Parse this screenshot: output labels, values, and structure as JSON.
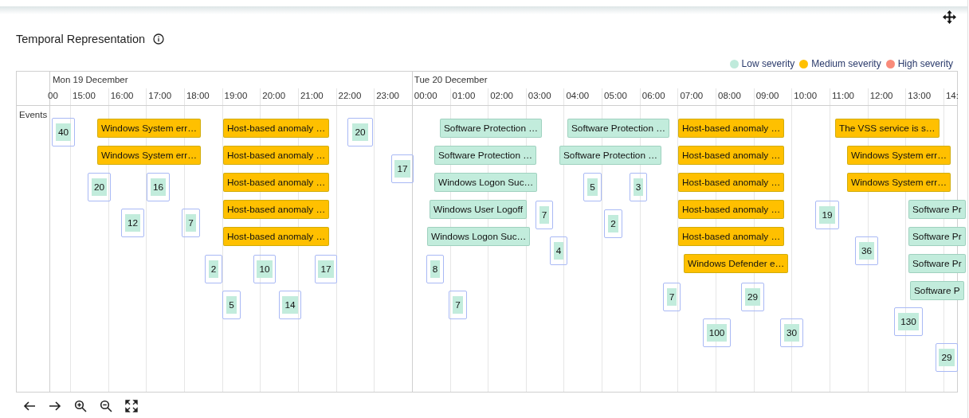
{
  "panel": {
    "title": "Temporal Representation"
  },
  "legend": [
    {
      "label": "Low severity",
      "color": "#bfeadb"
    },
    {
      "label": "Medium severity",
      "color": "#ffc000"
    },
    {
      "label": "High severity",
      "color": "#f98b7a"
    }
  ],
  "timeline": {
    "row_label": "Events",
    "days": [
      {
        "label": "Mon 19 December"
      },
      {
        "label": "Tue 20 December"
      }
    ],
    "hours": [
      {
        "label": "00"
      },
      {
        "label": "15:00"
      },
      {
        "label": "16:00"
      },
      {
        "label": "17:00"
      },
      {
        "label": "18:00"
      },
      {
        "label": "19:00"
      },
      {
        "label": "20:00"
      },
      {
        "label": "21:00"
      },
      {
        "label": "22:00"
      },
      {
        "label": "23:00"
      },
      {
        "label": "00:00"
      },
      {
        "label": "01:00"
      },
      {
        "label": "02:00"
      },
      {
        "label": "03:00"
      },
      {
        "label": "04:00"
      },
      {
        "label": "05:00"
      },
      {
        "label": "06:00"
      },
      {
        "label": "07:00"
      },
      {
        "label": "08:00"
      },
      {
        "label": "09:00"
      },
      {
        "label": "10:00"
      },
      {
        "label": "11:00"
      },
      {
        "label": "12:00"
      },
      {
        "label": "13:00"
      },
      {
        "label": "14:"
      }
    ],
    "events": [
      {
        "kind": "count",
        "text": "40",
        "color": "#c2ecdc"
      },
      {
        "kind": "label",
        "text": "Windows System err…",
        "color": "#ffc000"
      },
      {
        "kind": "label",
        "text": "Host-based anomaly …",
        "color": "#ffc000"
      },
      {
        "kind": "count",
        "text": "20",
        "color": "#c2ecdc"
      },
      {
        "kind": "label",
        "text": "Software Protection …",
        "color": "#c2ecdc"
      },
      {
        "kind": "label",
        "text": "Software Protection …",
        "color": "#c2ecdc"
      },
      {
        "kind": "label",
        "text": "Host-based anomaly …",
        "color": "#ffc000"
      },
      {
        "kind": "label",
        "text": "The VSS service is s…",
        "color": "#ffc000"
      },
      {
        "kind": "label",
        "text": "Windows System err…",
        "color": "#ffc000"
      },
      {
        "kind": "label",
        "text": "Host-based anomaly …",
        "color": "#ffc000"
      },
      {
        "kind": "label",
        "text": "Software Protection …",
        "color": "#c2ecdc"
      },
      {
        "kind": "label",
        "text": "Software Protection …",
        "color": "#c2ecdc"
      },
      {
        "kind": "label",
        "text": "Host-based anomaly …",
        "color": "#ffc000"
      },
      {
        "kind": "label",
        "text": "Windows System err…",
        "color": "#ffc000"
      },
      {
        "kind": "count",
        "text": "17",
        "color": "#c2ecdc"
      },
      {
        "kind": "count",
        "text": "20",
        "color": "#c2ecdc"
      },
      {
        "kind": "count",
        "text": "16",
        "color": "#c2ecdc"
      },
      {
        "kind": "label",
        "text": "Host-based anomaly …",
        "color": "#ffc000"
      },
      {
        "kind": "label",
        "text": "Windows Logon Suc…",
        "color": "#c2ecdc"
      },
      {
        "kind": "count",
        "text": "5",
        "color": "#c2ecdc"
      },
      {
        "kind": "count",
        "text": "3",
        "color": "#c2ecdc"
      },
      {
        "kind": "label",
        "text": "Host-based anomaly …",
        "color": "#ffc000"
      },
      {
        "kind": "label",
        "text": "Windows System err…",
        "color": "#ffc000"
      },
      {
        "kind": "label",
        "text": "Host-based anomaly …",
        "color": "#ffc000"
      },
      {
        "kind": "label",
        "text": "Windows User Logoff",
        "color": "#c2ecdc"
      },
      {
        "kind": "count",
        "text": "7",
        "color": "#c2ecdc"
      },
      {
        "kind": "label",
        "text": "Host-based anomaly …",
        "color": "#ffc000"
      },
      {
        "kind": "count",
        "text": "19",
        "color": "#c2ecdc"
      },
      {
        "kind": "label",
        "text": "Software Pr",
        "color": "#c2ecdc"
      },
      {
        "kind": "count",
        "text": "12",
        "color": "#c2ecdc"
      },
      {
        "kind": "count",
        "text": "7",
        "color": "#c2ecdc"
      },
      {
        "kind": "count",
        "text": "2",
        "color": "#c2ecdc"
      },
      {
        "kind": "label",
        "text": "Host-based anomaly …",
        "color": "#ffc000"
      },
      {
        "kind": "label",
        "text": "Windows Logon Suc…",
        "color": "#c2ecdc"
      },
      {
        "kind": "label",
        "text": "Host-based anomaly …",
        "color": "#ffc000"
      },
      {
        "kind": "label",
        "text": "Software Pr",
        "color": "#c2ecdc"
      },
      {
        "kind": "count",
        "text": "4",
        "color": "#c2ecdc"
      },
      {
        "kind": "count",
        "text": "36",
        "color": "#c2ecdc"
      },
      {
        "kind": "count",
        "text": "2",
        "color": "#c2ecdc"
      },
      {
        "kind": "count",
        "text": "10",
        "color": "#c2ecdc"
      },
      {
        "kind": "count",
        "text": "17",
        "color": "#c2ecdc"
      },
      {
        "kind": "count",
        "text": "8",
        "color": "#c2ecdc"
      },
      {
        "kind": "label",
        "text": "Windows Defender e…",
        "color": "#ffc000"
      },
      {
        "kind": "label",
        "text": "Software Pr",
        "color": "#c2ecdc"
      },
      {
        "kind": "label",
        "text": "Software P",
        "color": "#c2ecdc"
      },
      {
        "kind": "count",
        "text": "7",
        "color": "#c2ecdc"
      },
      {
        "kind": "count",
        "text": "29",
        "color": "#c2ecdc"
      },
      {
        "kind": "count",
        "text": "5",
        "color": "#c2ecdc"
      },
      {
        "kind": "count",
        "text": "14",
        "color": "#c2ecdc"
      },
      {
        "kind": "count",
        "text": "7",
        "color": "#c2ecdc"
      },
      {
        "kind": "count",
        "text": "130",
        "color": "#c2ecdc"
      },
      {
        "kind": "count",
        "text": "100",
        "color": "#c2ecdc"
      },
      {
        "kind": "count",
        "text": "30",
        "color": "#c2ecdc"
      },
      {
        "kind": "count",
        "text": "29",
        "color": "#c2ecdc"
      }
    ]
  }
}
